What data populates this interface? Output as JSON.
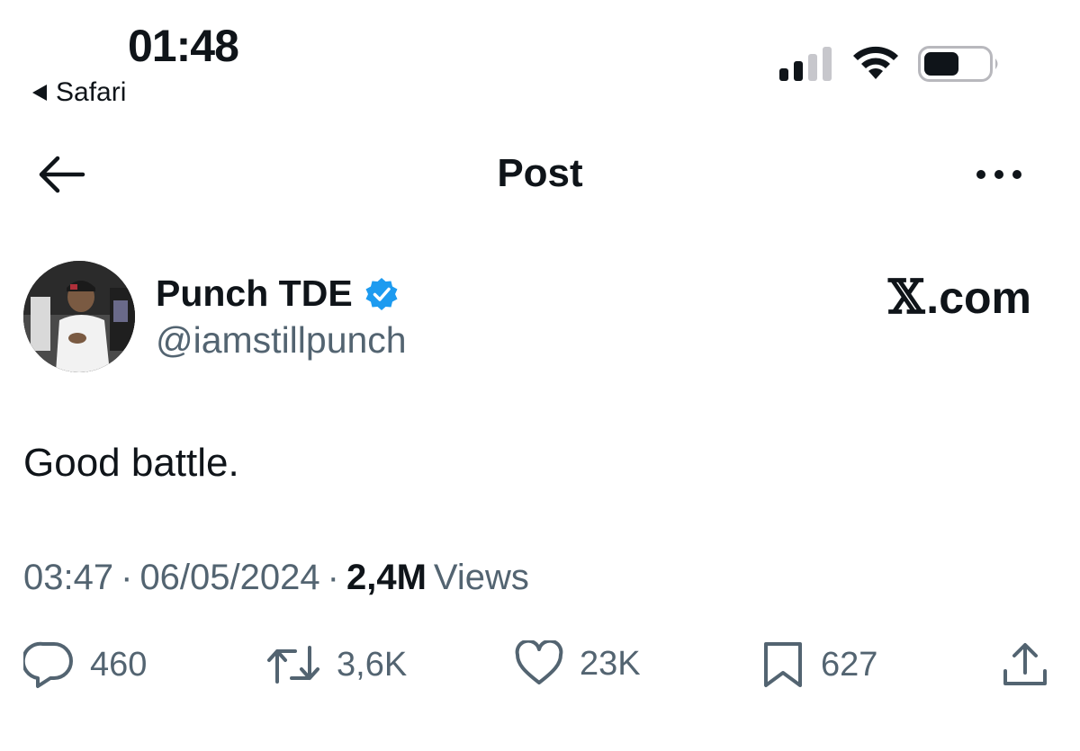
{
  "status_bar": {
    "time": "01:48",
    "back_app": "Safari"
  },
  "nav": {
    "title": "Post",
    "back_icon": "arrow-left-icon",
    "more_icon": "more-horizontal-icon"
  },
  "post": {
    "author": {
      "display_name": "Punch TDE",
      "handle": "@iamstillpunch",
      "verified": true
    },
    "brand": {
      "mark": "𝕏",
      "suffix": ".com"
    },
    "text": "Good battle.",
    "time": "03:47",
    "separator": "·",
    "date": "06/05/2024",
    "views_count": "2,4M",
    "views_label": "Views",
    "actions": {
      "replies": "460",
      "reposts": "3,6K",
      "likes": "23K",
      "bookmarks": "627"
    }
  },
  "colors": {
    "text": "#0f1419",
    "secondary": "#536471",
    "verified_blue": "#1d9bf0"
  }
}
